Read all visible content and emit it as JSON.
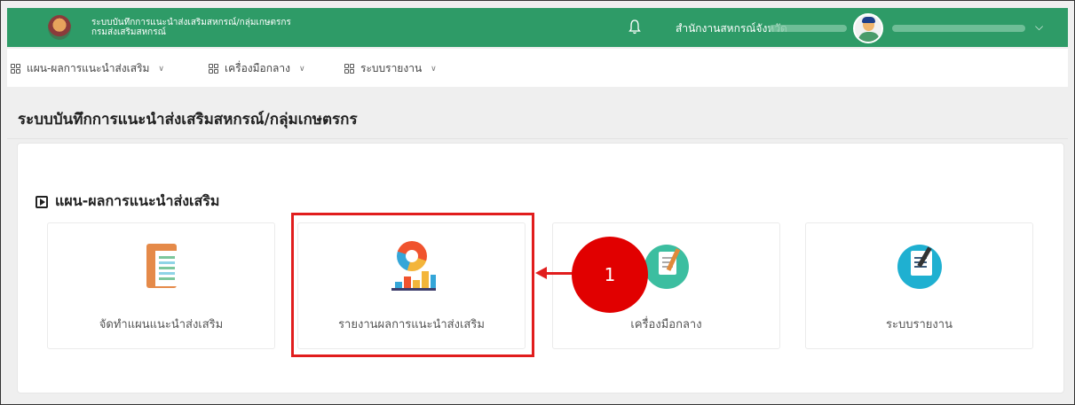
{
  "header": {
    "app_title": "ระบบบันทึกการแนะนำส่งเสริมสหกรณ์/กลุ่มเกษตรกร",
    "app_subtitle": "กรมส่งเสริมสหกรณ์",
    "org_label": "สำนักงานสหกรณ์จังหวัด",
    "icons": {
      "notification": "bell-icon",
      "user_menu": "chevron-down-icon"
    },
    "colors": {
      "bar": "#2e9b67"
    }
  },
  "menu": {
    "items": [
      {
        "label": "แผน-ผลการแนะนำส่งเสริม"
      },
      {
        "label": "เครื่องมือกลาง"
      },
      {
        "label": "ระบบรายงาน"
      }
    ]
  },
  "page": {
    "title": "ระบบบันทึกการแนะนำส่งเสริมสหกรณ์/กลุ่มเกษตรกร"
  },
  "section": {
    "title": "แผน-ผลการแนะนำส่งเสริม",
    "tiles": [
      {
        "label": "จัดทำแผนแนะนำส่งเสริม",
        "icon": "clipboard-icon"
      },
      {
        "label": "รายงานผลการแนะนำส่งเสริม",
        "icon": "chart-icon"
      },
      {
        "label": "เครื่องมือกลาง",
        "icon": "notebook-icon"
      },
      {
        "label": "ระบบรายงาน",
        "icon": "report-icon"
      }
    ]
  },
  "annotation": {
    "badge": "1",
    "color": "#e11d1d"
  }
}
